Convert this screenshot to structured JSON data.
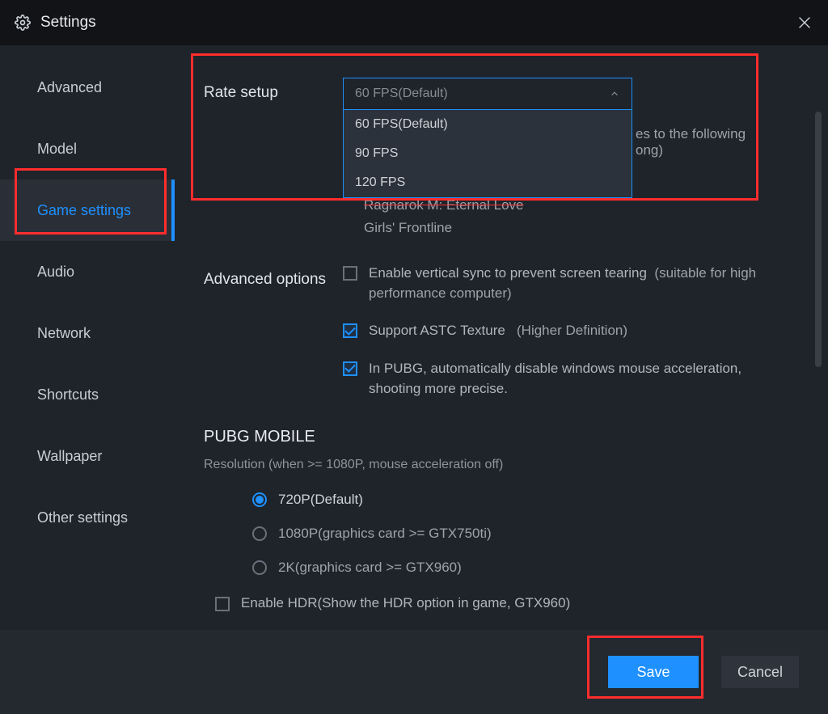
{
  "header": {
    "title": "Settings"
  },
  "sidebar": {
    "items": [
      {
        "label": "Advanced"
      },
      {
        "label": "Model"
      },
      {
        "label": "Game settings"
      },
      {
        "label": "Audio"
      },
      {
        "label": "Network"
      },
      {
        "label": "Shortcuts"
      },
      {
        "label": "Wallpaper"
      },
      {
        "label": "Other settings"
      }
    ],
    "active_index": 2
  },
  "rate": {
    "label": "Rate setup",
    "selected": "60 FPS(Default)",
    "options": [
      "60 FPS(Default)",
      "90 FPS",
      "120 FPS"
    ],
    "hint_tail_line1": "es to the following",
    "hint_tail_line2": "ong)",
    "game_list": [
      "Ragnarok M: Eternal Love",
      "Girls' Frontline"
    ]
  },
  "advanced": {
    "label": "Advanced options",
    "opt_vsync": "Enable vertical sync to prevent screen tearing",
    "opt_vsync_note": "(suitable for high performance computer)",
    "opt_astc": "Support ASTC Texture",
    "opt_astc_note": "(Higher Definition)",
    "opt_pubg_accel": "In PUBG, automatically disable windows mouse acceleration, shooting more precise.",
    "vsync_checked": false,
    "astc_checked": true,
    "pubg_accel_checked": true
  },
  "pubg": {
    "heading": "PUBG MOBILE",
    "res_note": "Resolution (when >= 1080P, mouse acceleration off)",
    "options": [
      "720P(Default)",
      "1080P(graphics card >= GTX750ti)",
      "2K(graphics card >= GTX960)"
    ],
    "selected_index": 0,
    "hdr_label": "Enable HDR(Show the HDR option in game, GTX960)",
    "hdr_checked": false
  },
  "footer": {
    "save": "Save",
    "cancel": "Cancel"
  }
}
